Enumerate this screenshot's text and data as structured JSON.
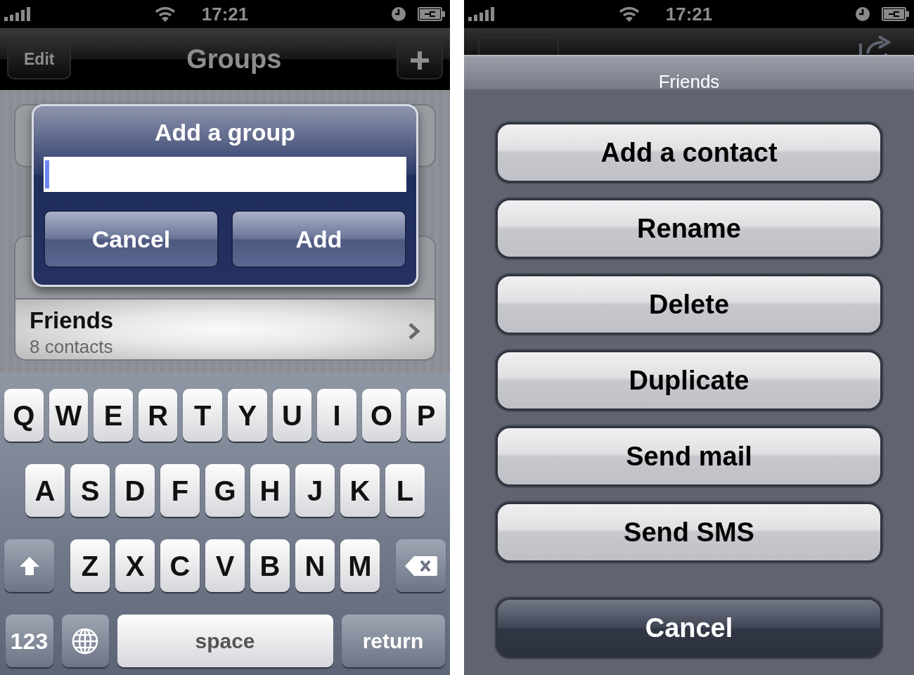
{
  "left_screen": {
    "status_bar": {
      "time": "17:21"
    },
    "nav_bar": {
      "left_button": "Edit",
      "title": "Groups"
    },
    "friends_row": {
      "name": "Friends",
      "count": "8 contacts",
      "selected": true
    },
    "alert": {
      "title": "Add a group",
      "input": {
        "focused": true
      },
      "buttons": [
        "Cancel",
        "Add"
      ]
    },
    "keyboard": {
      "top_row": [
        "Q",
        "W",
        "E",
        "R",
        "T",
        "Y",
        "U",
        "I",
        "O",
        "P"
      ],
      "middle_row": [
        "A",
        "S",
        "D",
        "F",
        "G",
        "H",
        "J",
        "K",
        "L"
      ],
      "bottom_row": [
        "Z",
        "X",
        "C",
        "V",
        "B",
        "N",
        "M"
      ],
      "function_keys": [
        {
          "kind": "shift"
        },
        {
          "kind": "delete"
        },
        {
          "kind": "mode",
          "label": "123"
        },
        {
          "kind": "globe"
        },
        {
          "kind": "space",
          "label": "space"
        },
        {
          "kind": "return",
          "label": "return"
        }
      ]
    }
  },
  "right_screen": {
    "status_bar": {
      "time": "17:21"
    },
    "action_sheet": {
      "title": "Friends",
      "buttons": [
        {
          "label": "Add a contact",
          "kind": "default"
        },
        {
          "label": "Rename",
          "kind": "default"
        },
        {
          "label": "Delete",
          "kind": "default"
        },
        {
          "label": "Duplicate",
          "kind": "default"
        },
        {
          "label": "Send mail",
          "kind": "default"
        },
        {
          "label": "Send SMS",
          "kind": "default"
        },
        {
          "label": "Cancel",
          "kind": "cancel"
        }
      ]
    }
  }
}
